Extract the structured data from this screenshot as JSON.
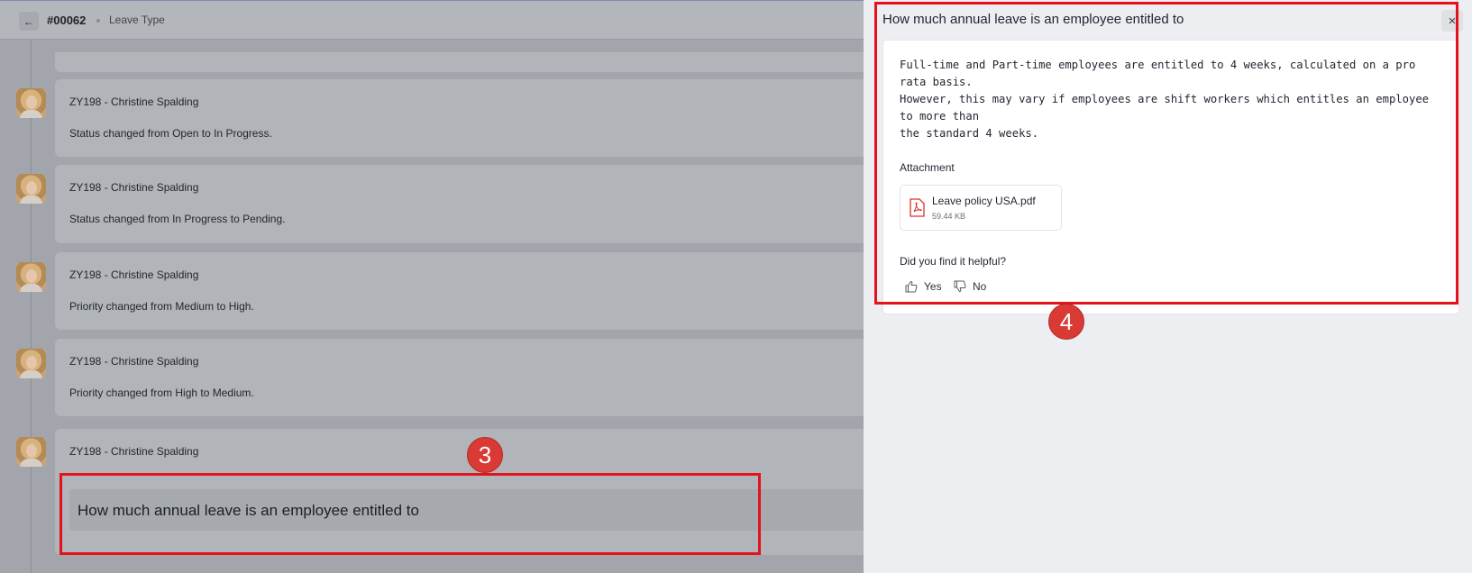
{
  "header": {
    "back_icon": "arrow-left-icon",
    "ticket_id": "#00062",
    "breadcrumb": "Leave Type"
  },
  "timeline": [
    {
      "author": "ZY198 - Christine Spalding",
      "message": "Status changed from Open to In Progress."
    },
    {
      "author": "ZY198 - Christine Spalding",
      "message": "Status changed from In Progress to Pending."
    },
    {
      "author": "ZY198 - Christine Spalding",
      "message": "Priority changed from Medium to High."
    },
    {
      "author": "ZY198 - Christine Spalding",
      "message": "Priority changed from High to Medium."
    },
    {
      "author": "ZY198 - Christine Spalding",
      "message": ""
    }
  ],
  "article_link": "How much annual leave is an employee entitled to",
  "annotations": {
    "left_badge": "3",
    "right_badge": "4",
    "color": "#e3121b"
  },
  "drawer": {
    "title": "How much annual leave is an employee entitled to",
    "close_icon": "close-icon",
    "answer_lines": [
      "Full-time and Part-time employees are entitled to 4 weeks, calculated on a pro rata basis.",
      "However, this may vary if employees are shift workers which entitles an employee to more than",
      "the standard 4 weeks."
    ],
    "attachment_label": "Attachment",
    "attachment": {
      "icon": "pdf-file-icon",
      "name": "Leave policy USA.pdf",
      "size": "59.44 KB"
    },
    "helpful_question": "Did you find it helpful?",
    "yes_label": "Yes",
    "no_label": "No"
  }
}
